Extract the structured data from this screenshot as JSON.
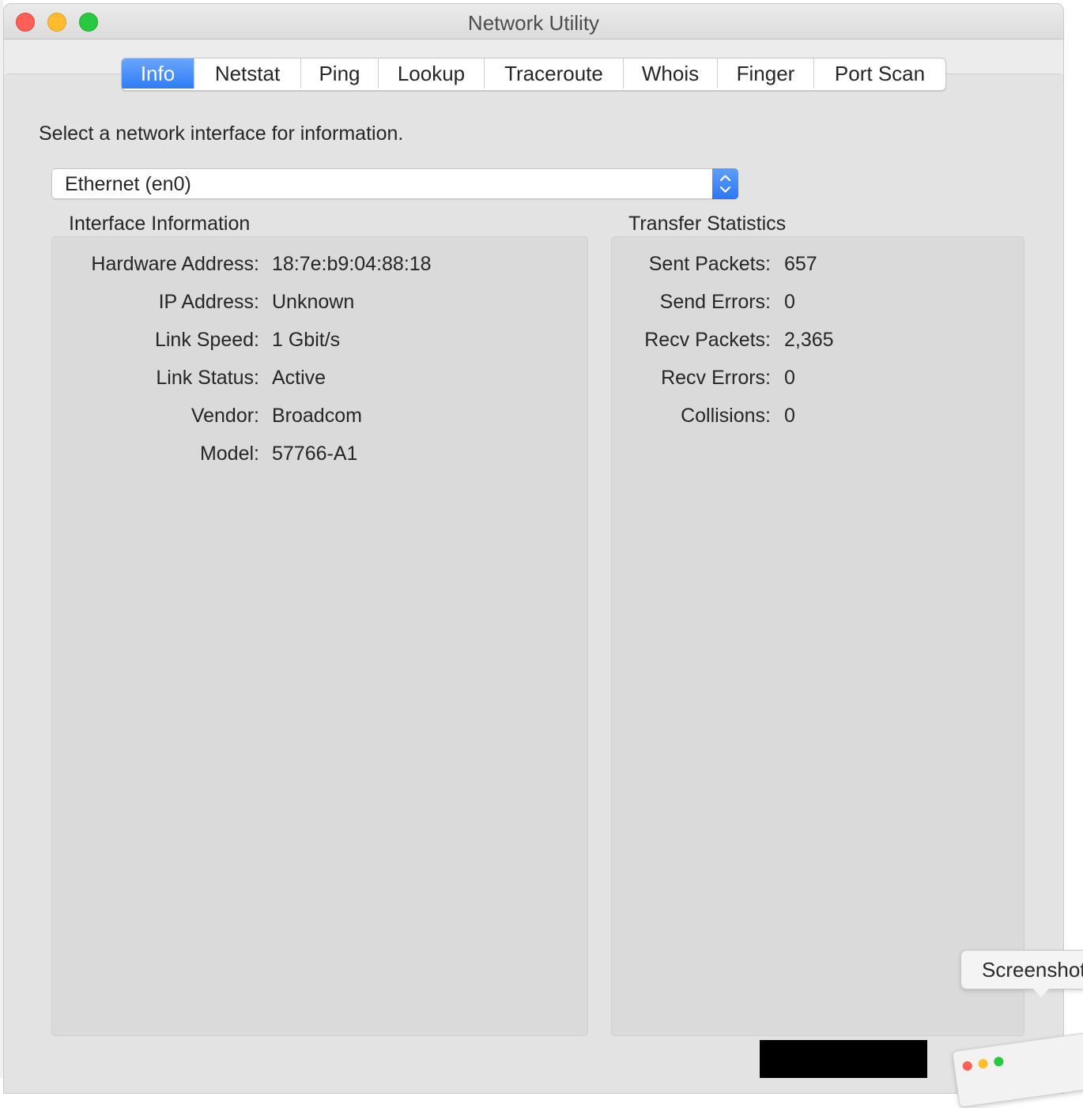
{
  "window": {
    "title": "Network Utility"
  },
  "tabs": [
    {
      "label": "Info",
      "active": true
    },
    {
      "label": "Netstat",
      "active": false
    },
    {
      "label": "Ping",
      "active": false
    },
    {
      "label": "Lookup",
      "active": false
    },
    {
      "label": "Traceroute",
      "active": false
    },
    {
      "label": "Whois",
      "active": false
    },
    {
      "label": "Finger",
      "active": false
    },
    {
      "label": "Port Scan",
      "active": false
    }
  ],
  "info": {
    "prompt": "Select a network interface for information.",
    "interface_select": {
      "value": "Ethernet (en0)"
    },
    "interface_information": {
      "title": "Interface Information",
      "rows": [
        {
          "label": "Hardware Address:",
          "value": "18:7e:b9:04:88:18"
        },
        {
          "label": "IP Address:",
          "value": "Unknown"
        },
        {
          "label": "Link Speed:",
          "value": "1 Gbit/s"
        },
        {
          "label": "Link Status:",
          "value": "Active"
        },
        {
          "label": "Vendor:",
          "value": "Broadcom"
        },
        {
          "label": "Model:",
          "value": "57766-A1"
        }
      ]
    },
    "transfer_statistics": {
      "title": "Transfer Statistics",
      "rows": [
        {
          "label": "Sent Packets:",
          "value": "657"
        },
        {
          "label": "Send Errors:",
          "value": "0"
        },
        {
          "label": "Recv Packets:",
          "value": "2,365"
        },
        {
          "label": "Recv Errors:",
          "value": "0"
        },
        {
          "label": "Collisions:",
          "value": "0"
        }
      ]
    }
  },
  "overlay": {
    "tooltip": "Screenshot"
  },
  "colors": {
    "accent": "#2e7cf6",
    "close": "#fe5f57",
    "minimize": "#febc2e",
    "maximize": "#28c840"
  }
}
